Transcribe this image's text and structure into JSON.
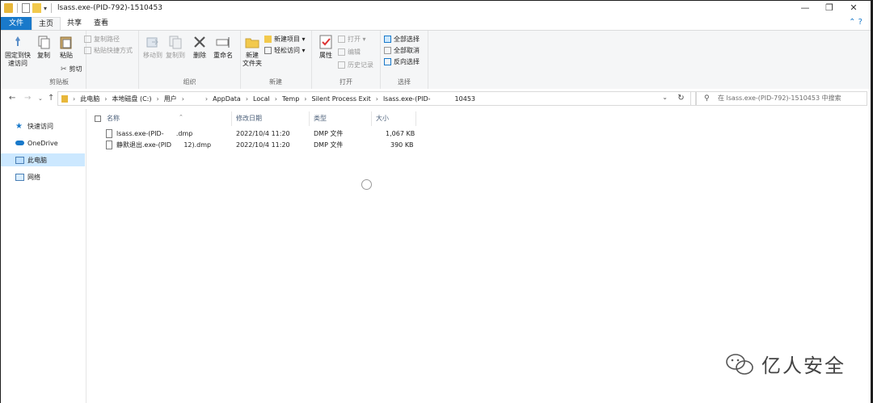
{
  "window": {
    "title": "lsass.exe-(PID-792)-1510453"
  },
  "titlebar": {
    "minimize": "—",
    "maximize": "❐",
    "close": "✕"
  },
  "tabs": [
    {
      "label": "文件"
    },
    {
      "label": "主页"
    },
    {
      "label": "共享"
    },
    {
      "label": "查看"
    }
  ],
  "ribbon": {
    "clipboard": {
      "label": "剪贴板",
      "pin": "固定到快\n速访问",
      "copy": "复制",
      "paste": "粘贴",
      "copy_path": "复制路径",
      "paste_shortcut": "粘贴快捷方式",
      "cut": "剪切"
    },
    "organize": {
      "label": "组织",
      "move_to": "移动到",
      "copy_to": "复制到",
      "delete": "删除",
      "rename": "重命名"
    },
    "new": {
      "label": "新建",
      "new_folder": "新建\n文件夹",
      "new_item": "新建项目 ▾",
      "easy_access": "轻松访问 ▾"
    },
    "open": {
      "label": "打开",
      "properties": "属性",
      "open": "打开 ▾",
      "edit": "编辑",
      "history": "历史记录"
    },
    "select": {
      "label": "选择",
      "select_all": "全部选择",
      "select_none": "全部取消",
      "invert": "反向选择"
    }
  },
  "address": {
    "crumbs": [
      "此电脑",
      "本地磁盘 (C:)",
      "用户",
      "",
      "AppData",
      "Local",
      "Temp",
      "Silent Process Exit",
      "lsass.exe-(PID-",
      "10453"
    ],
    "search_placeholder": "在 lsass.exe-(PID-792)-1510453 中搜索"
  },
  "nav": [
    {
      "label": "快速访问",
      "icon": "star-icon"
    },
    {
      "label": "OneDrive",
      "icon": "cloud-icon"
    },
    {
      "label": "此电脑",
      "icon": "computer-icon",
      "selected": true
    },
    {
      "label": "网络",
      "icon": "network-icon"
    }
  ],
  "columns": {
    "name": "名称",
    "modified": "修改日期",
    "type": "类型",
    "size": "大小"
  },
  "files": [
    {
      "name": "lsass.exe-(PID-      .dmp",
      "modified": "2022/10/4 11:20",
      "type": "DMP 文件",
      "size": "1,067 KB"
    },
    {
      "name": "静默退出.exe-(PID      12).dmp",
      "modified": "2022/10/4 11:20",
      "type": "DMP 文件",
      "size": "390 KB"
    }
  ],
  "watermark": {
    "text": "亿人安全"
  },
  "colors": {
    "accent": "#1979ca",
    "selection": "#cce8ff",
    "folder": "#e8b73a"
  }
}
